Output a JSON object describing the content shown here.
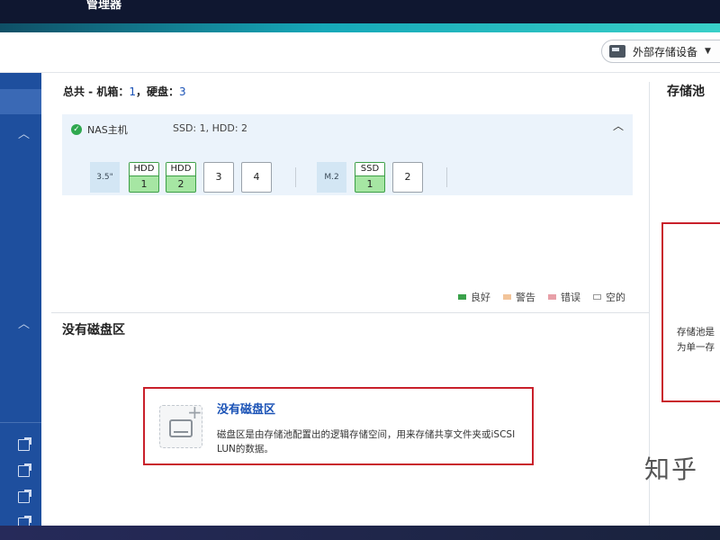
{
  "app": {
    "title": "管理器"
  },
  "toolbar": {
    "external_storage_label": "外部存储设备",
    "external_storage_icon": "external-drive-icon"
  },
  "sidebar": {
    "icons": [
      "chevron-up-icon",
      "chevron-up-icon",
      "external-link-icon",
      "external-link-icon",
      "external-link-icon",
      "external-link-icon"
    ]
  },
  "summary": {
    "prefix": "总共 - 机箱：",
    "enclosure_count": "1",
    "sep": "，硬盘：",
    "disk_count": "3"
  },
  "enclosure": {
    "name": "NAS主机",
    "status": "ok",
    "info": "SSD: 1, HDD: 2",
    "groups": [
      {
        "label": "3.5\"",
        "slots": [
          {
            "kind": "HDD",
            "number": "1",
            "state": "filled"
          },
          {
            "kind": "HDD",
            "number": "2",
            "state": "filled"
          },
          {
            "kind": "",
            "number": "3",
            "state": "empty"
          },
          {
            "kind": "",
            "number": "4",
            "state": "empty"
          }
        ]
      },
      {
        "label": "M.2",
        "slots": [
          {
            "kind": "SSD",
            "number": "1",
            "state": "filled"
          },
          {
            "kind": "",
            "number": "2",
            "state": "empty"
          }
        ]
      }
    ]
  },
  "legend": [
    {
      "label": "良好",
      "color": "#3ba24b"
    },
    {
      "label": "警告",
      "color": "#f2c49a"
    },
    {
      "label": "错误",
      "color": "#e8a0a8"
    },
    {
      "label": "空的",
      "color": "#ffffff"
    }
  ],
  "volumes": {
    "section_title": "没有磁盘区",
    "empty_title": "没有磁盘区",
    "empty_desc": "磁盘区是由存储池配置出的逻辑存储空间，用来存储共享文件夹或iSCSI LUN的数据。"
  },
  "pool": {
    "title": "存储池",
    "desc_line1": "存储池是",
    "desc_line2": "为单一存"
  },
  "watermark": "知乎",
  "colors": {
    "accent_blue": "#1a52b6",
    "sidebar": "#1e4f9e",
    "highlight_red": "#c9202b",
    "healthy_green": "#3ba24b"
  }
}
